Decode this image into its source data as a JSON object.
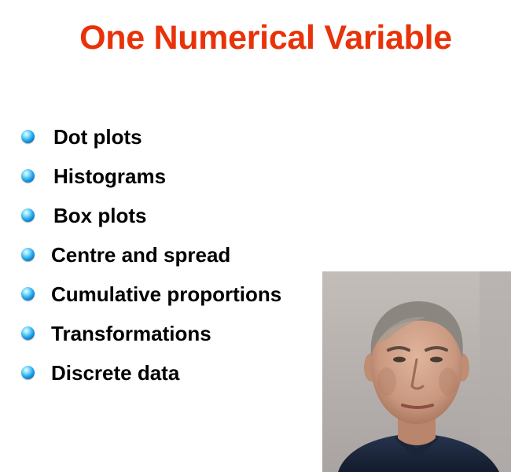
{
  "slide": {
    "title": "One Numerical Variable",
    "title_color": "#e8330a",
    "bullet_color": "#1ea3e8",
    "items": [
      {
        "label": "Dot plots"
      },
      {
        "label": "Histograms"
      },
      {
        "label": "Box plots"
      },
      {
        "label": "Centre and spread"
      },
      {
        "label": "Cumulative proportions"
      },
      {
        "label": "Transformations"
      },
      {
        "label": "Discrete data"
      }
    ]
  }
}
